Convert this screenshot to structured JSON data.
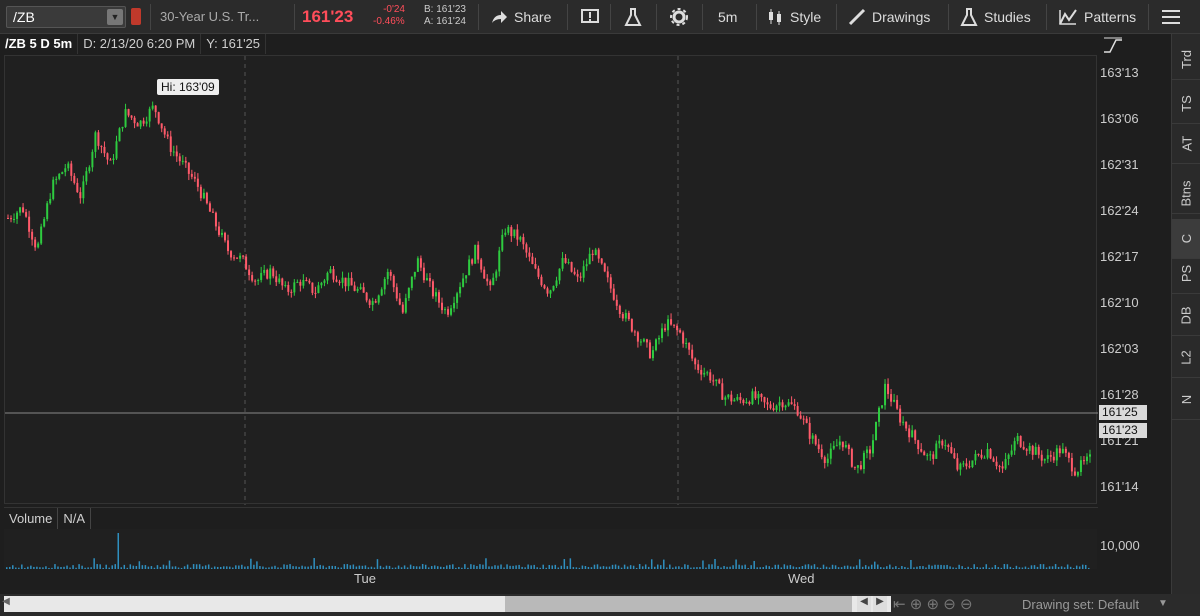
{
  "toolbar": {
    "symbol": "/ZB",
    "description": "30-Year U.S. Tr...",
    "last_price": "161'23",
    "net_change": "-0'24",
    "pct_change": "-0.46%",
    "bid": "B: 161'23",
    "ask": "A: 161'24",
    "share_label": "Share",
    "timeframe_label": "5m",
    "style_label": "Style",
    "drawings_label": "Drawings",
    "studies_label": "Studies",
    "patterns_label": "Patterns"
  },
  "chart_header": {
    "title": "/ZB 5 D 5m",
    "date": "D: 2/13/20 6:20 PM",
    "y_value": "Y: 161'25"
  },
  "hi_callout": "Hi: 163'09",
  "y_axis": {
    "ticks": [
      "163'13",
      "163'06",
      "162'31",
      "162'24",
      "162'17",
      "162'10",
      "162'03",
      "161'28",
      "161'21",
      "161'14"
    ],
    "crosshair_tag": "161'25",
    "last_tag": "161'23"
  },
  "x_axis": {
    "ticks": [
      "Tue",
      "Wed"
    ]
  },
  "volume": {
    "label": "Volume",
    "value": "N/A",
    "axis_tick": "10,000"
  },
  "sidebar": [
    "Trd",
    "TS",
    "AT",
    "Btns",
    "C",
    "PS",
    "DB",
    "L2",
    "N"
  ],
  "drawing_set": "Drawing set: Default",
  "colors": {
    "up": "#2ecc40",
    "down": "#ff5a6a",
    "last": "#ff4d5a"
  },
  "chart_data": {
    "type": "candlestick",
    "x": [
      "Tue",
      "Wed"
    ],
    "close_path": [
      162.75,
      162.8,
      162.6,
      162.9,
      163.0,
      162.85,
      163.15,
      163.0,
      163.25,
      163.2,
      163.28,
      163.1,
      163.0,
      162.9,
      162.75,
      162.6,
      162.55,
      162.45,
      162.5,
      162.4,
      162.45,
      162.4,
      162.5,
      162.45,
      162.4,
      162.35,
      162.5,
      162.3,
      162.55,
      162.4,
      162.3,
      162.45,
      162.6,
      162.4,
      162.7,
      162.65,
      162.5,
      162.4,
      162.55,
      162.45,
      162.6,
      162.45,
      162.3,
      162.2,
      162.1,
      162.25,
      162.2,
      162.05,
      162.0,
      161.9,
      161.88,
      161.9,
      161.85,
      161.88,
      161.84,
      161.7,
      161.6,
      161.7,
      161.55,
      161.65,
      161.95,
      161.8,
      161.7,
      161.6,
      161.7,
      161.55,
      161.6,
      161.65,
      161.55,
      161.7,
      161.65,
      161.6,
      161.65,
      161.55,
      161.6
    ],
    "y_ticks": [
      "163'13",
      "163'06",
      "162'31",
      "162'24",
      "162'17",
      "162'10",
      "162'03",
      "161'28",
      "161'21",
      "161'14"
    ]
  }
}
